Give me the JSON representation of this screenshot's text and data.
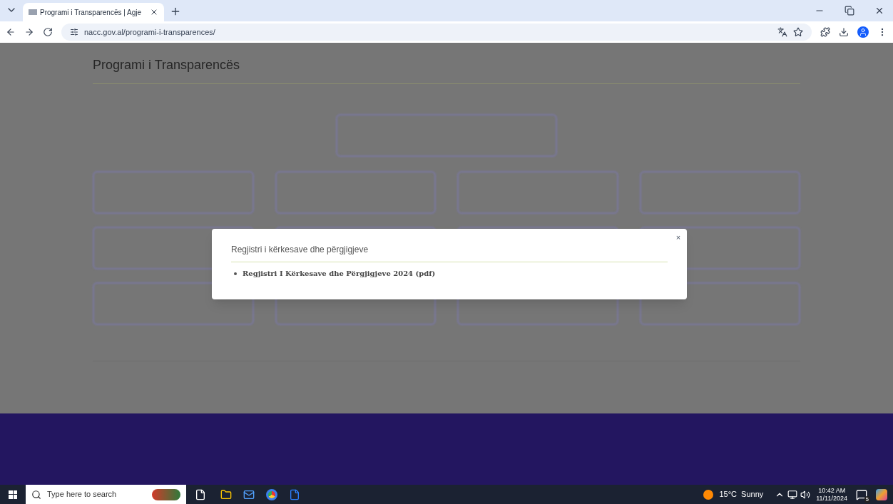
{
  "browser": {
    "tab_title": "Programi i Transparencës | Agje",
    "url": "nacc.gov.al/programi-i-transparences/"
  },
  "page": {
    "title": "Programi i Transparencës"
  },
  "modal": {
    "title": "Regjistri i kërkesave dhe përgjigjeve",
    "close": "×",
    "links": [
      "Regjistri I Kërkesave dhe Përgjigjeve 2024 (pdf)"
    ]
  },
  "taskbar": {
    "search_placeholder": "Type here to search",
    "weather": "15°C  Sunny",
    "time": "10:42 AM",
    "date": "11/11/2024",
    "notifications": "5"
  }
}
